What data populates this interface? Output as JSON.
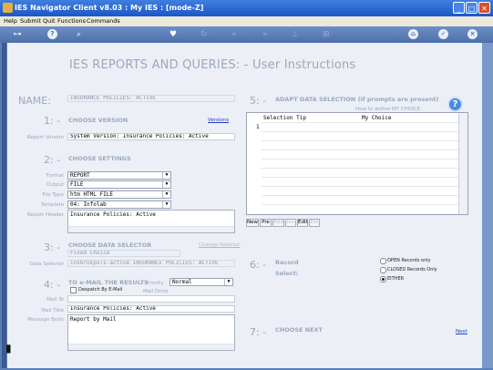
{
  "window": {
    "title": "IES Navigator Client v8.03 : My IES :      [mode-Z]"
  },
  "menu": [
    "Help",
    "Submit",
    "Quit",
    "Functions",
    "Commands"
  ],
  "toolbar": {
    "icons": [
      "key-icon",
      "help-icon",
      "search-icon",
      "heart-icon",
      "refresh-icon",
      "back-icon",
      "forward-icon",
      "pin-icon",
      "grid-icon",
      "home-icon",
      "check-icon",
      "close-icon"
    ]
  },
  "page": {
    "title": "IES REPORTS AND QUERIES: -   User Instructions"
  },
  "name": {
    "label": "NAME:",
    "value": "INSURANCE POLICIES: ACTIVE"
  },
  "sec1": {
    "num": "1: -",
    "title": "CHOOSE VERSION",
    "link": "Versions",
    "report_version_label": "Report Version",
    "report_version": "System Version: Insurance Policies: Active"
  },
  "sec2": {
    "num": "2: -",
    "title": "CHOOSE SETTINGS",
    "format_label": "Format",
    "format": "REPORT",
    "output_label": "Output",
    "output": "FILE",
    "filetype_label": "File Type",
    "filetype": "htm HTML FILE",
    "template_label": "Template",
    "template": "04: Infolab",
    "header_label": "Report Header",
    "header": "Insurance Policies: Active"
  },
  "sec3": {
    "num": "3: -",
    "title": "CHOOSE DATA SELECTOR",
    "link": "Change Selector",
    "fixed": "Fixed Choice",
    "selector_label": "Data Selector",
    "selector": "insbrokpols-active INSURANCE POLICIES: ACTIVE"
  },
  "sec4": {
    "num": "4: -",
    "title": "TO e-MAIL THE RESULTS",
    "priority_label": "Priority",
    "priority": "Normal",
    "despatch_label": "Despatch By E-Mail",
    "maildrive_label": "Mail Drive",
    "mailto_label": "Mail To",
    "mailtitle_label": "Mail Title",
    "mailtitle": "Insurance Policies: Active",
    "body_label": "Message Body",
    "body": "Report by Mail"
  },
  "sec5": {
    "num": "5: -",
    "title": "ADAPT DATA SELECTION (if prompts are present)",
    "howto": "How to define MY CHOICE",
    "col1": "Selection Tip",
    "col2": "My Choice",
    "row_index": "1",
    "nav": [
      "New",
      "Pre",
      "Add",
      "Ins",
      "Edit",
      "Del"
    ]
  },
  "sec6": {
    "num": "6: -",
    "title_line1": "Record",
    "title_line2": "Select:",
    "options": [
      "OPEN Records only",
      "CLOSED Records Only",
      "EITHER"
    ],
    "selected": "EITHER"
  },
  "sec7": {
    "num": "7: -",
    "title": "CHOOSE NEXT",
    "next": "Next"
  },
  "colors": {
    "titlebar": "#1b56c8",
    "content_bg": "#eceff5",
    "label": "#9aa8bf",
    "link": "#2040c0"
  }
}
